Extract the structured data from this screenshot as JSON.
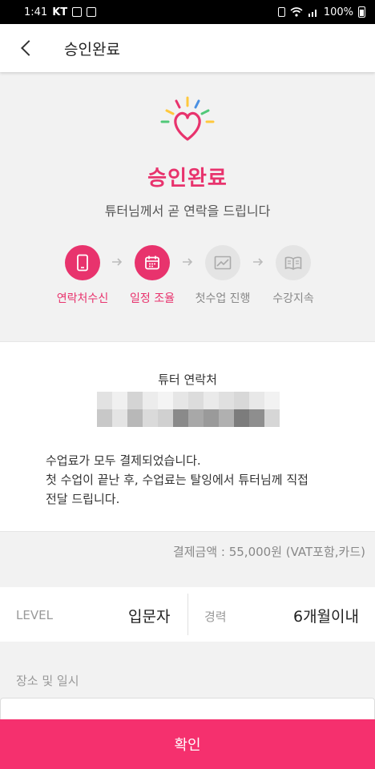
{
  "status_bar": {
    "time": "1:41",
    "carrier": "KT",
    "battery": "100%"
  },
  "header": {
    "title": "승인완료",
    "back_icon": "chevron-left-icon"
  },
  "hero": {
    "title": "승인완료",
    "subtitle": "튜터님께서 곧 연락을 드립니다",
    "accent_color": "#e8336d"
  },
  "steps": [
    {
      "label": "연락처수신",
      "icon": "phone-icon",
      "active": true
    },
    {
      "label": "일정 조율",
      "icon": "calendar-icon",
      "active": true
    },
    {
      "label": "첫수업 진행",
      "icon": "chart-icon",
      "active": false
    },
    {
      "label": "수강지속",
      "icon": "book-icon",
      "active": false
    }
  ],
  "contact": {
    "title": "튜터 연락처",
    "message_line1": "수업료가 모두 결제되었습니다.",
    "message_line2": "첫 수업이 끝난 후, 수업료는 탈잉에서 튜터님께 직접",
    "message_line3": "전달 드립니다."
  },
  "payment": {
    "text": "결제금액 : 55,000원 (VAT포함,카드)"
  },
  "info": {
    "level_label": "LEVEL",
    "level_value": "입문자",
    "career_label": "경력",
    "career_value": "6개월이내"
  },
  "place": {
    "label": "장소 및 일시"
  },
  "confirm_button": {
    "label": "확인",
    "color": "#f5306e"
  }
}
